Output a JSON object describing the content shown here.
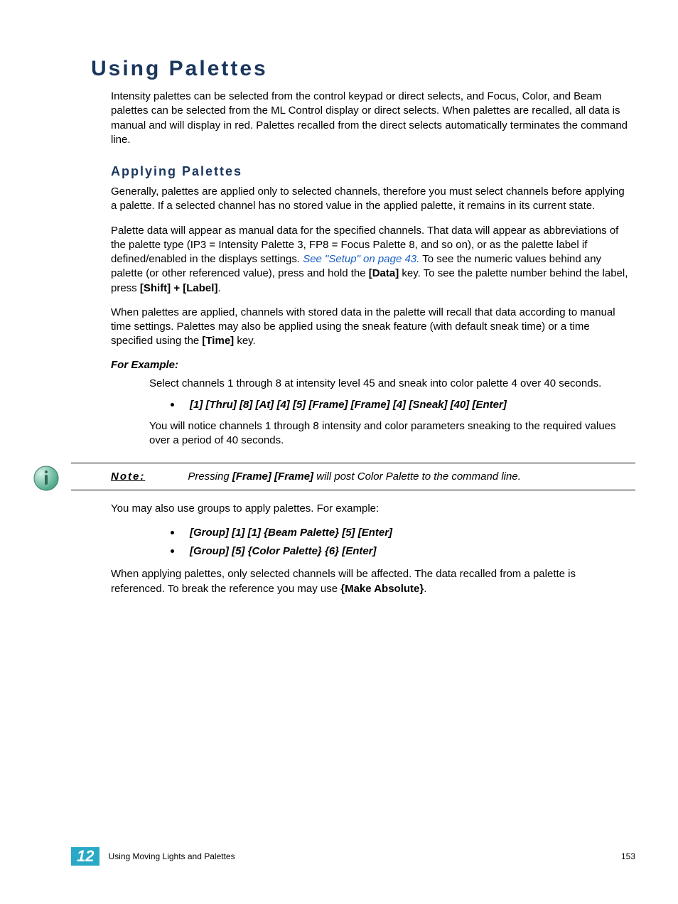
{
  "title": "Using Palettes",
  "intro": "Intensity palettes can be selected from the control keypad or direct selects, and Focus, Color, and Beam palettes can be selected from the ML Control display or direct selects. When palettes are recalled, all data is manual and will display in red. Palettes recalled from the direct selects automatically terminates the command line.",
  "section1": {
    "heading": "Applying Palettes",
    "p1": "Generally, palettes are applied only to selected channels, therefore you must select channels before applying a palette. If a selected channel has no stored value in the applied palette, it remains in its current state.",
    "p2a": "Palette data will appear as manual data for the specified channels. That data will appear as abbreviations of the palette type (IP3 = Intensity Palette 3, FP8 = Focus Palette 8, and so on), or as the palette label if defined/enabled in the displays settings. ",
    "p2link": "See \"Setup\" on page 43.",
    "p2b": " To see the numeric values behind any palette (or other referenced value), press and hold the ",
    "p2key1": "[Data]",
    "p2c": " key. To see the palette number behind the label, press ",
    "p2key2": "[Shift] + [Label]",
    "p2d": ".",
    "p3a": "When palettes are applied, channels with stored data in the palette will recall that data according to manual time settings. Palettes may also be applied using the sneak feature (with default sneak time) or a time specified using the ",
    "p3key": "[Time]",
    "p3b": " key.",
    "forExample": "For Example:",
    "ex1": "Select channels 1 through 8 at intensity level 45 and sneak into color palette 4 over 40 seconds.",
    "exBullet": "[1] [Thru] [8] [At] [4] [5] [Frame] [Frame] [4] [Sneak] [40] [Enter]",
    "ex2": "You will notice channels 1 through 8 intensity and color parameters sneaking to the required values over a period of 40 seconds.",
    "noteLabel": "Note:",
    "noteA": "Pressing ",
    "noteKey": "[Frame] [Frame]",
    "noteB": " will post Color Palette to the command line.",
    "p4": "You may also use groups to apply palettes. For example:",
    "bullets2": [
      "[Group] [1] [1] {Beam Palette} [5] [Enter]",
      "[Group] [5] {Color Palette} {6} [Enter]"
    ],
    "p5a": "When applying palettes, only selected channels will be affected. The data recalled from a palette is referenced. To break the reference you may use ",
    "p5key": "{Make Absolute}",
    "p5b": "."
  },
  "footer": {
    "chapter": "12",
    "title": "Using Moving Lights and Palettes",
    "page": "153"
  }
}
